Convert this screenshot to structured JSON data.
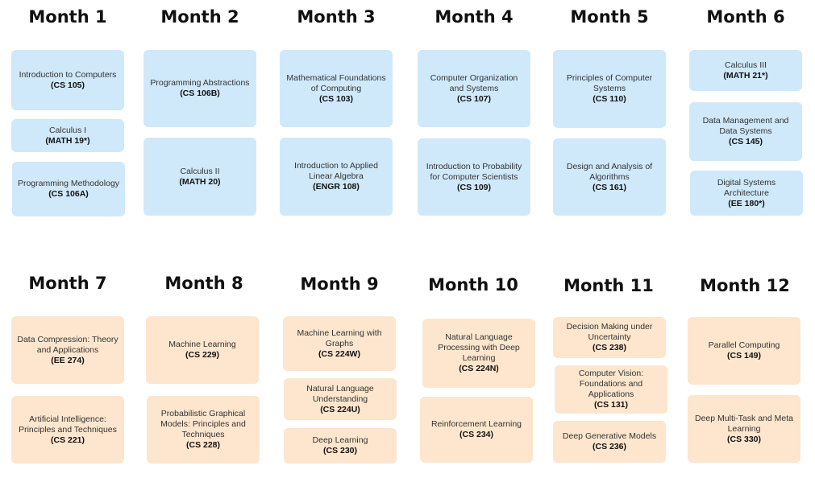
{
  "colors": {
    "blue_card": "#cfe9fb",
    "peach_card": "#fde6cd"
  },
  "months": [
    {
      "title": "Month 1",
      "courses": [
        {
          "name": "Introduction to Computers",
          "code": "(CS 105)"
        },
        {
          "name": "Calculus I",
          "code": "(MATH 19*)"
        },
        {
          "name": "Programming Methodology",
          "code": "(CS 106A)"
        }
      ]
    },
    {
      "title": "Month 2",
      "courses": [
        {
          "name": "Programming Abstractions",
          "code": "(CS 106B)"
        },
        {
          "name": "Calculus II",
          "code": "(MATH 20)"
        }
      ]
    },
    {
      "title": "Month 3",
      "courses": [
        {
          "name": "Mathematical Foundations of Computing",
          "code": "(CS 103)"
        },
        {
          "name": "Introduction to Applied Linear Algebra",
          "code": "(ENGR 108)"
        }
      ]
    },
    {
      "title": "Month 4",
      "courses": [
        {
          "name": "Computer Organization and Systems",
          "code": "(CS 107)"
        },
        {
          "name": "Introduction to Probability for Computer Scientists",
          "code": "(CS 109)"
        }
      ]
    },
    {
      "title": "Month 5",
      "courses": [
        {
          "name": "Principles of Computer Systems",
          "code": "(CS 110)"
        },
        {
          "name": "Design and Analysis of Algorithms",
          "code": "(CS 161)"
        }
      ]
    },
    {
      "title": "Month 6",
      "courses": [
        {
          "name": "Calculus III",
          "code": "(MATH 21*)"
        },
        {
          "name": "Data Management and Data Systems",
          "code": "(CS 145)"
        },
        {
          "name": "Digital Systems Architecture",
          "code": "(EE 180*)"
        }
      ]
    },
    {
      "title": "Month 7",
      "courses": [
        {
          "name": "Data Compression: Theory and Applications",
          "code": "(EE 274)"
        },
        {
          "name": "Artificial Intelligence: Principles and Techniques",
          "code": "(CS 221)"
        }
      ]
    },
    {
      "title": "Month 8",
      "courses": [
        {
          "name": "Machine Learning",
          "code": "(CS 229)"
        },
        {
          "name": "Probabilistic Graphical Models: Principles and Techniques",
          "code": "(CS 228)"
        }
      ]
    },
    {
      "title": "Month 9",
      "courses": [
        {
          "name": "Machine Learning with Graphs",
          "code": "(CS 224W)"
        },
        {
          "name": "Natural Language Understanding",
          "code": "(CS 224U)"
        },
        {
          "name": "Deep Learning",
          "code": "(CS 230)"
        }
      ]
    },
    {
      "title": "Month 10",
      "courses": [
        {
          "name": "Natural Language Processing with Deep Learning",
          "code": "(CS 224N)"
        },
        {
          "name": "Reinforcement Learning",
          "code": "(CS 234)"
        }
      ]
    },
    {
      "title": "Month 11",
      "courses": [
        {
          "name": "Decision Making under Uncertainty",
          "code": "(CS 238)"
        },
        {
          "name": "Computer Vision: Foundations and Applications",
          "code": "(CS 131)"
        },
        {
          "name": "Deep Generative Models",
          "code": "(CS 236)"
        }
      ]
    },
    {
      "title": "Month 12",
      "courses": [
        {
          "name": "Parallel Computing",
          "code": "(CS 149)"
        },
        {
          "name": "Deep Multi-Task and Meta Learning",
          "code": "(CS 330)"
        }
      ]
    }
  ]
}
